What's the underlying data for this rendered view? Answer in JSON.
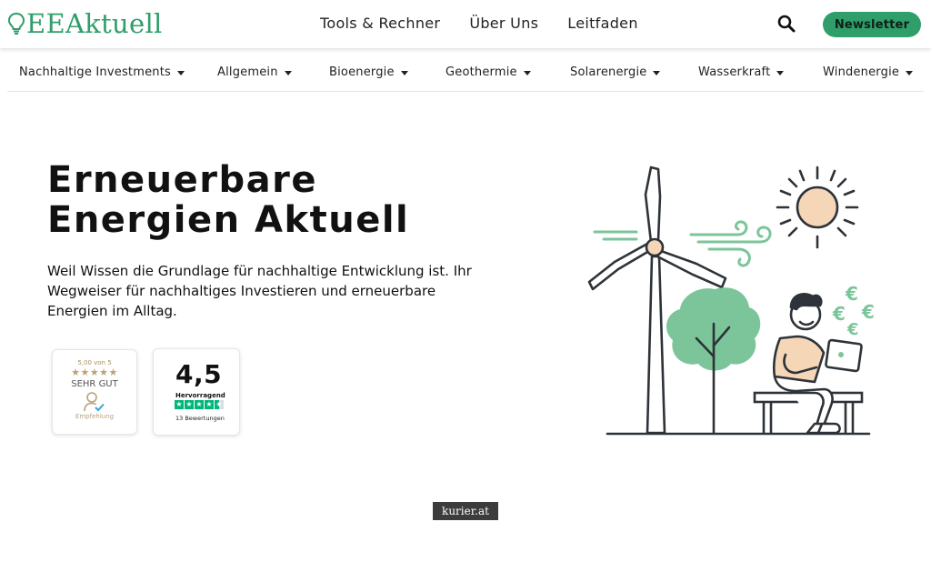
{
  "brand": {
    "name": "EEAktuell",
    "color": "#2f9e6a"
  },
  "topnav": {
    "items": [
      {
        "label": "Tools & Rechner"
      },
      {
        "label": "Über Uns"
      },
      {
        "label": "Leitfaden"
      }
    ],
    "search_icon": "search-icon",
    "newsletter_label": "Newsletter"
  },
  "categories": [
    {
      "label": "Nachhaltige Investments"
    },
    {
      "label": "Allgemein"
    },
    {
      "label": "Bioenergie"
    },
    {
      "label": "Geothermie"
    },
    {
      "label": "Solarenergie"
    },
    {
      "label": "Wasserkraft"
    },
    {
      "label": "Windenergie"
    }
  ],
  "hero": {
    "title_line1": "Erneuerbare",
    "title_line2": "Energien Aktuell",
    "subtitle": "Weil Wissen die Grundlage für nachhaltige Entwicklung ist. Ihr Wegweiser für nachhaltiges Investieren und erneuerbare Energien im Alltag."
  },
  "badge_rating": {
    "score_text": "5,00 von 5",
    "stars": "★★★★★",
    "label": "SEHR GUT",
    "footer": "Empfehlung"
  },
  "badge_trust": {
    "score": "4,5",
    "label": "Hervorragend",
    "stars_value": 4.5,
    "count": "13 Bewertungen",
    "star_color": "#00b67a"
  },
  "press": {
    "label": "kurier.at"
  },
  "illustration": {
    "euro_symbol": "€"
  }
}
